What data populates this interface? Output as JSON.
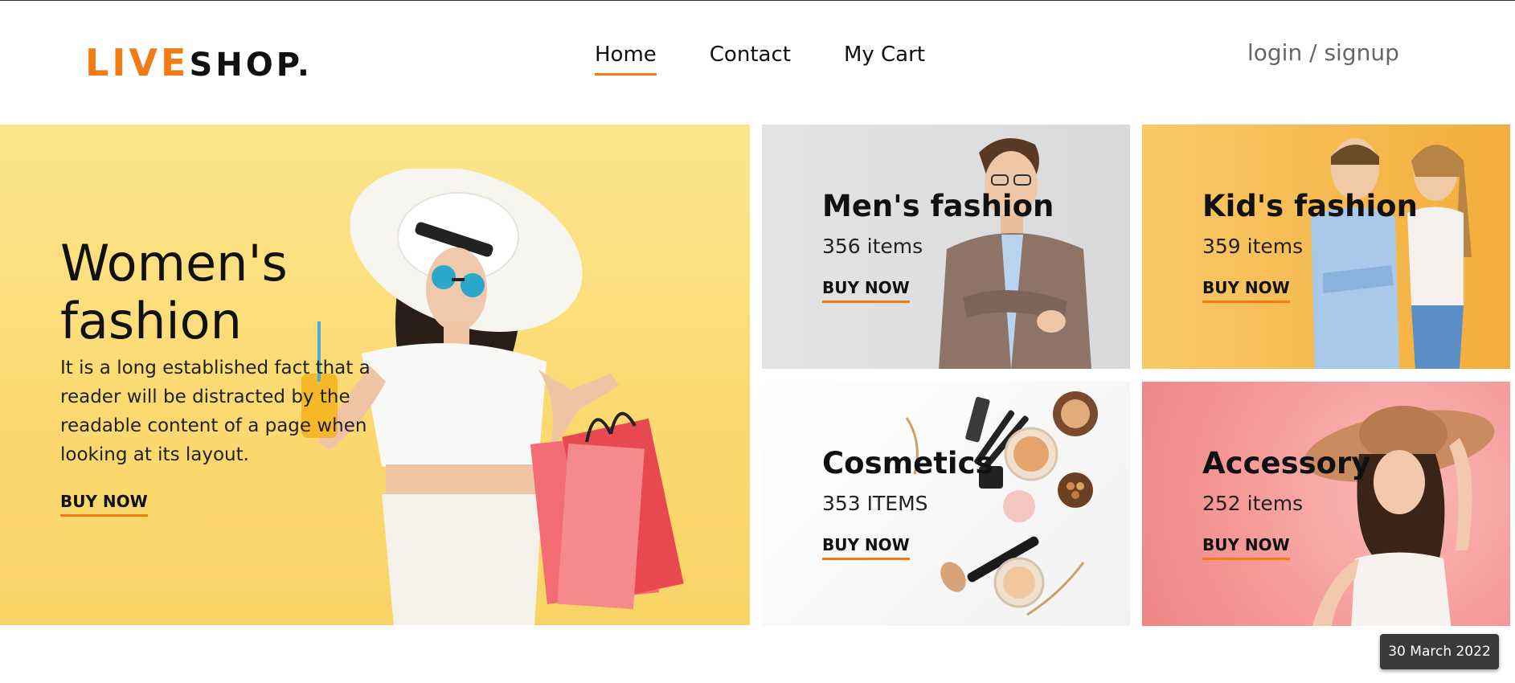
{
  "brand": {
    "part1": "LIVE",
    "part2": "SHOP",
    "dot": ".",
    "accent": "#f47b12"
  },
  "nav": {
    "home": "Home",
    "contact": "Contact",
    "cart": "My Cart"
  },
  "auth": {
    "label": "login / signup"
  },
  "featured": {
    "title_line1": "Women's",
    "title_line2": "fashion",
    "description": "It is a long established fact that a reader will be distracted by the readable content of a page when looking at its layout.",
    "cta": "BUY NOW",
    "image": "woman-with-hat-and-shopping-bags"
  },
  "categories": [
    {
      "title": "Men's fashion",
      "count": "356 items",
      "cta": "BUY NOW",
      "image": "man-in-blazer"
    },
    {
      "title": "Kid's fashion",
      "count": "359 items",
      "cta": "BUY NOW",
      "image": "two-kids"
    },
    {
      "title": "Cosmetics",
      "count": "353 ITEMS",
      "cta": "BUY NOW",
      "image": "makeup-products"
    },
    {
      "title": "Accessory",
      "count": "252 items",
      "cta": "BUY NOW",
      "image": "woman-with-sun-hat"
    }
  ],
  "date_badge": "30 March 2022"
}
